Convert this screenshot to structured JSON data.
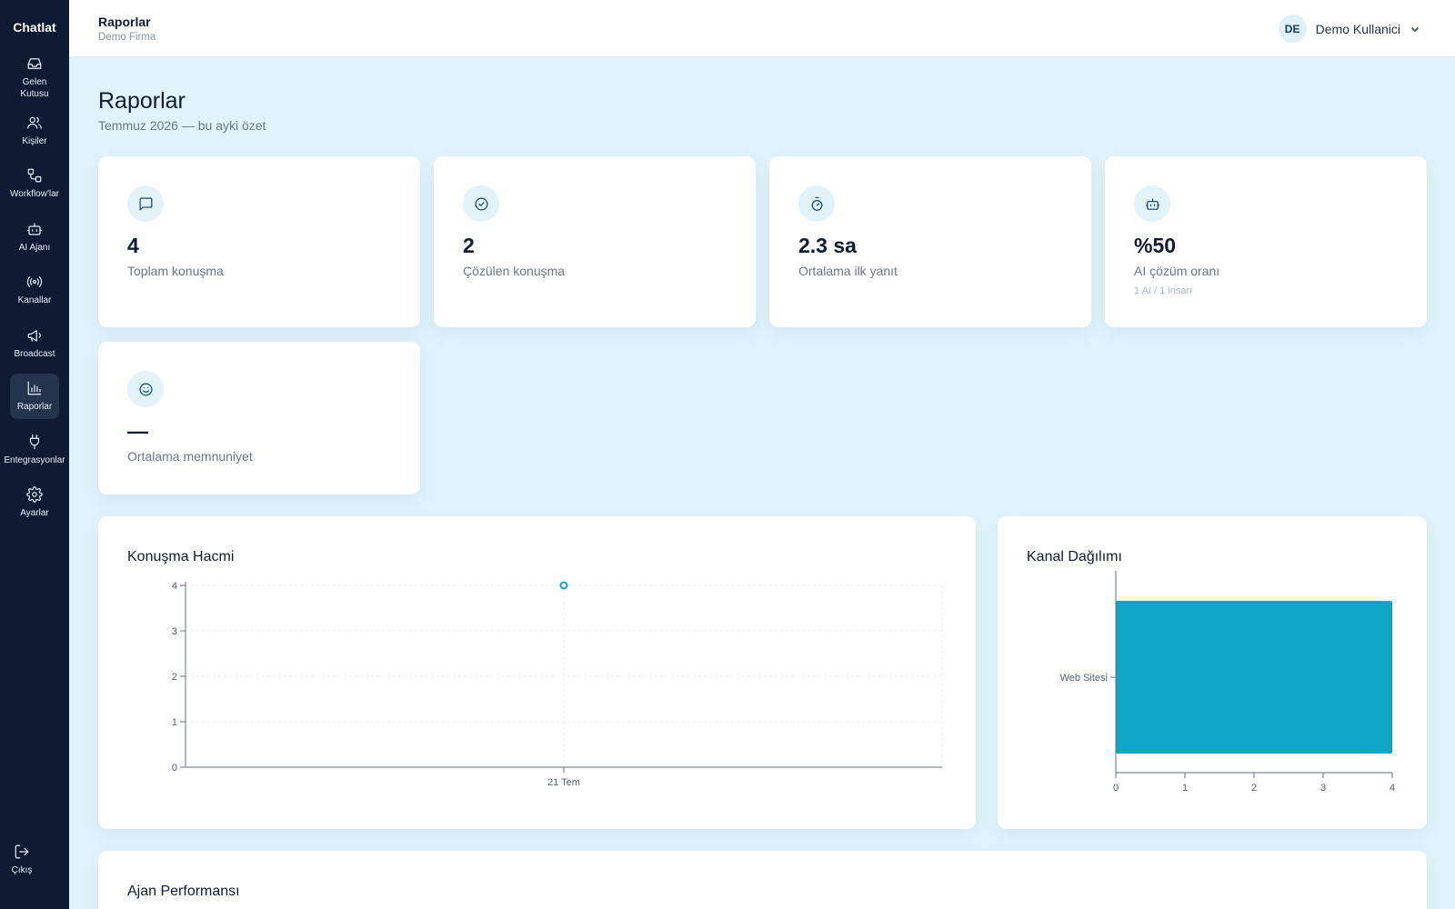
{
  "sidebar": {
    "brand": "Chatlat",
    "items": [
      {
        "label": "Gelen Kutusu",
        "icon": "inbox-icon"
      },
      {
        "label": "Kişiler",
        "icon": "users-icon"
      },
      {
        "label": "Workflow'lar",
        "icon": "workflow-icon"
      },
      {
        "label": "AI Ajanı",
        "icon": "bot-icon"
      },
      {
        "label": "Kanallar",
        "icon": "radio-icon"
      },
      {
        "label": "Broadcast",
        "icon": "megaphone-icon"
      },
      {
        "label": "Raporlar",
        "icon": "bar-chart-icon",
        "active": true
      },
      {
        "label": "Entegrasyonlar",
        "icon": "plug-icon"
      },
      {
        "label": "Ayarlar",
        "icon": "gear-icon"
      }
    ],
    "logout_label": "Çıkış"
  },
  "topbar": {
    "title": "Raporlar",
    "subtitle": "Demo Firma",
    "user_initials": "DE",
    "user_name": "Demo Kullanici"
  },
  "page": {
    "title": "Raporlar",
    "subtitle": "Temmuz 2026 — bu ayki özet"
  },
  "stats": [
    {
      "icon": "message-icon",
      "value": "4",
      "label": "Toplam konuşma"
    },
    {
      "icon": "check-circle-icon",
      "value": "2",
      "label": "Çözülen konuşma"
    },
    {
      "icon": "timer-icon",
      "value": "2.3 sa",
      "label": "Ortalama ilk yanıt"
    },
    {
      "icon": "bot-icon",
      "value": "%50",
      "label": "AI çözüm oranı",
      "note": "1 AI / 1 insan"
    },
    {
      "icon": "smile-icon",
      "value": "—",
      "label": "Ortalama memnuniyet"
    }
  ],
  "panels": {
    "volume_title": "Konuşma Hacmi",
    "channel_title": "Kanal Dağılımı",
    "agents_title": "Ajan Performansı"
  },
  "colors": {
    "accent": "#0ea5c6",
    "sidebar": "#0e1b33",
    "background": "#e1f3fa"
  },
  "chart_data": [
    {
      "type": "line",
      "title": "Konuşma Hacmi",
      "x": [
        "21 Tem"
      ],
      "series": [
        {
          "values": [
            4
          ]
        }
      ],
      "ylim": [
        0,
        4
      ],
      "yticks": [
        0,
        1,
        2,
        3,
        4
      ],
      "grid": true
    },
    {
      "type": "bar",
      "orientation": "horizontal",
      "title": "Kanal Dağılımı",
      "categories": [
        "Web Sitesi"
      ],
      "values": [
        4
      ],
      "xlim": [
        0,
        4
      ],
      "xticks": [
        0,
        1,
        2,
        3,
        4
      ],
      "color": "#0ea5c6"
    }
  ]
}
